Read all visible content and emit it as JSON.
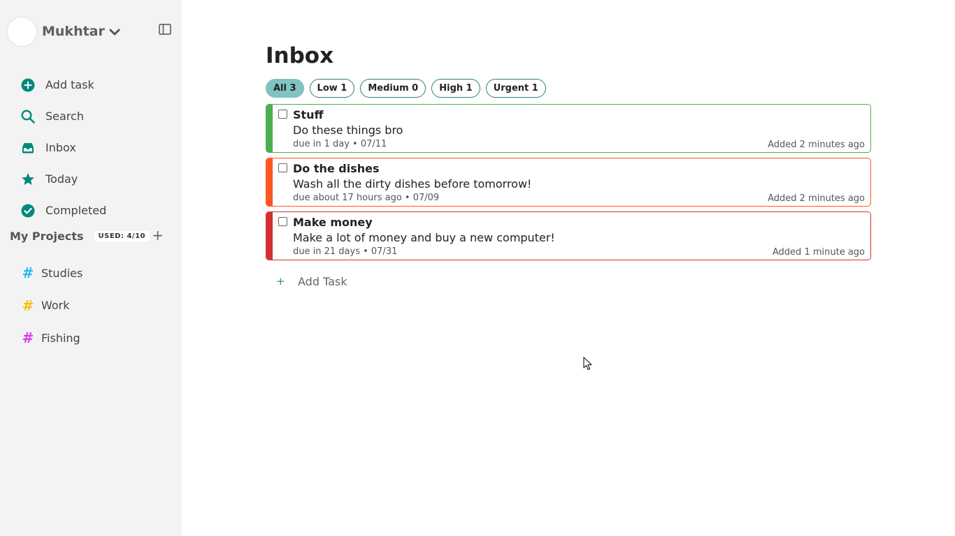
{
  "user": {
    "name": "Mukhtar"
  },
  "nav": [
    {
      "label": "Add task",
      "icon": "plus-circle-icon"
    },
    {
      "label": "Search",
      "icon": "search-icon"
    },
    {
      "label": "Inbox",
      "icon": "inbox-icon"
    },
    {
      "label": "Today",
      "icon": "star-icon"
    },
    {
      "label": "Completed",
      "icon": "check-circle-icon"
    }
  ],
  "projects": {
    "title": "My Projects",
    "used": "USED: 4/10",
    "add_label": "+",
    "items": [
      {
        "label": "Studies",
        "color": "#29b6f6"
      },
      {
        "label": "Work",
        "color": "#f9c00c"
      },
      {
        "label": "Fishing",
        "color": "#d63ce8"
      }
    ]
  },
  "main": {
    "title": "Inbox",
    "filters": [
      {
        "label": "All 3",
        "active": true
      },
      {
        "label": "Low 1",
        "active": false
      },
      {
        "label": "Medium 0",
        "active": false
      },
      {
        "label": "High 1",
        "active": false
      },
      {
        "label": "Urgent 1",
        "active": false
      }
    ],
    "tasks": [
      {
        "title": "Stuff",
        "description": "Do these things bro",
        "due": "due in 1 day • 07/11",
        "added": "Added 2 minutes ago",
        "color": "#4caf50"
      },
      {
        "title": "Do the dishes",
        "description": "Wash all the dirty dishes before tomorrow!",
        "due": "due about 17 hours ago • 07/09",
        "added": "Added 2 minutes ago",
        "color": "#ff5722"
      },
      {
        "title": "Make money",
        "description": "Make a lot of money and buy a new computer!",
        "due": "due in 21 days • 07/31",
        "added": "Added 1 minute ago",
        "color": "#d32f2f"
      }
    ],
    "add_task_label": "Add Task"
  },
  "colors": {
    "accent": "#00897b",
    "sidebar_bg": "#f3f3f3"
  }
}
